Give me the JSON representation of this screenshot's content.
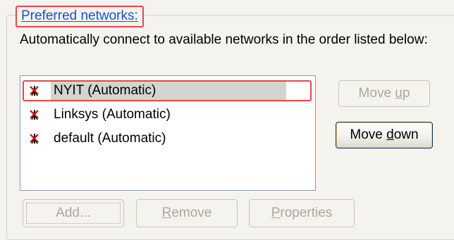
{
  "preferred_networks": {
    "legend": "Preferred networks:",
    "description": "Automatically connect to available networks in the order listed below:",
    "networks": [
      {
        "name": "NYIT (Automatic)",
        "selected": true,
        "icon": "wireless-network-unavailable-icon"
      },
      {
        "name": "Linksys (Automatic)",
        "selected": false,
        "icon": "wireless-network-unavailable-icon"
      },
      {
        "name": "default (Automatic)",
        "selected": false,
        "icon": "wireless-network-unavailable-icon"
      }
    ]
  },
  "buttons": {
    "move_up": {
      "pre": "Move ",
      "mnemonic": "u",
      "post": "p",
      "enabled": false
    },
    "move_down": {
      "pre": "Move ",
      "mnemonic": "d",
      "post": "own",
      "enabled": true
    },
    "add": {
      "label": "Add...",
      "enabled": false
    },
    "remove": {
      "pre": "",
      "mnemonic": "R",
      "post": "emove",
      "enabled": false
    },
    "properties": {
      "pre": "",
      "mnemonic": "P",
      "post": "roperties",
      "enabled": false
    }
  },
  "colors": {
    "highlight_outline": "#e7474b",
    "legend_text": "#1a52c9",
    "selection_bg": "#d5d4d1"
  }
}
